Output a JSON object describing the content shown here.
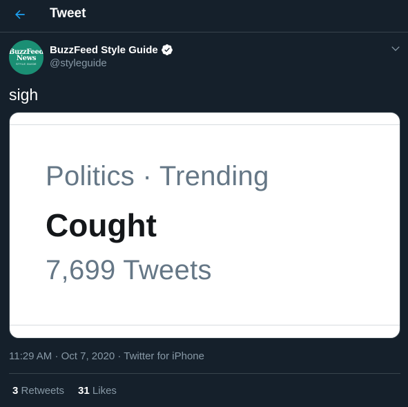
{
  "header": {
    "title": "Tweet",
    "back_icon": "back-arrow-icon",
    "accent": "#1da1f2"
  },
  "author": {
    "avatar": {
      "line1": "BuzzFeed",
      "line2": "News",
      "line3": "STYLE GUIDE",
      "bg": "#1b8f74"
    },
    "display_name": "BuzzFeed Style Guide",
    "verified_icon": "verified-badge-icon",
    "handle": "@styleguide"
  },
  "tweet": {
    "text": "sigh",
    "media": {
      "context": "Politics · Trending",
      "trend": "Cought",
      "count": "7,699 Tweets"
    }
  },
  "meta": {
    "time": "11:29 AM",
    "date": "Oct 7, 2020",
    "separator": "·",
    "source": "Twitter for iPhone"
  },
  "stats": {
    "retweets": {
      "count": "3",
      "label": "Retweets"
    },
    "likes": {
      "count": "31",
      "label": "Likes"
    }
  }
}
